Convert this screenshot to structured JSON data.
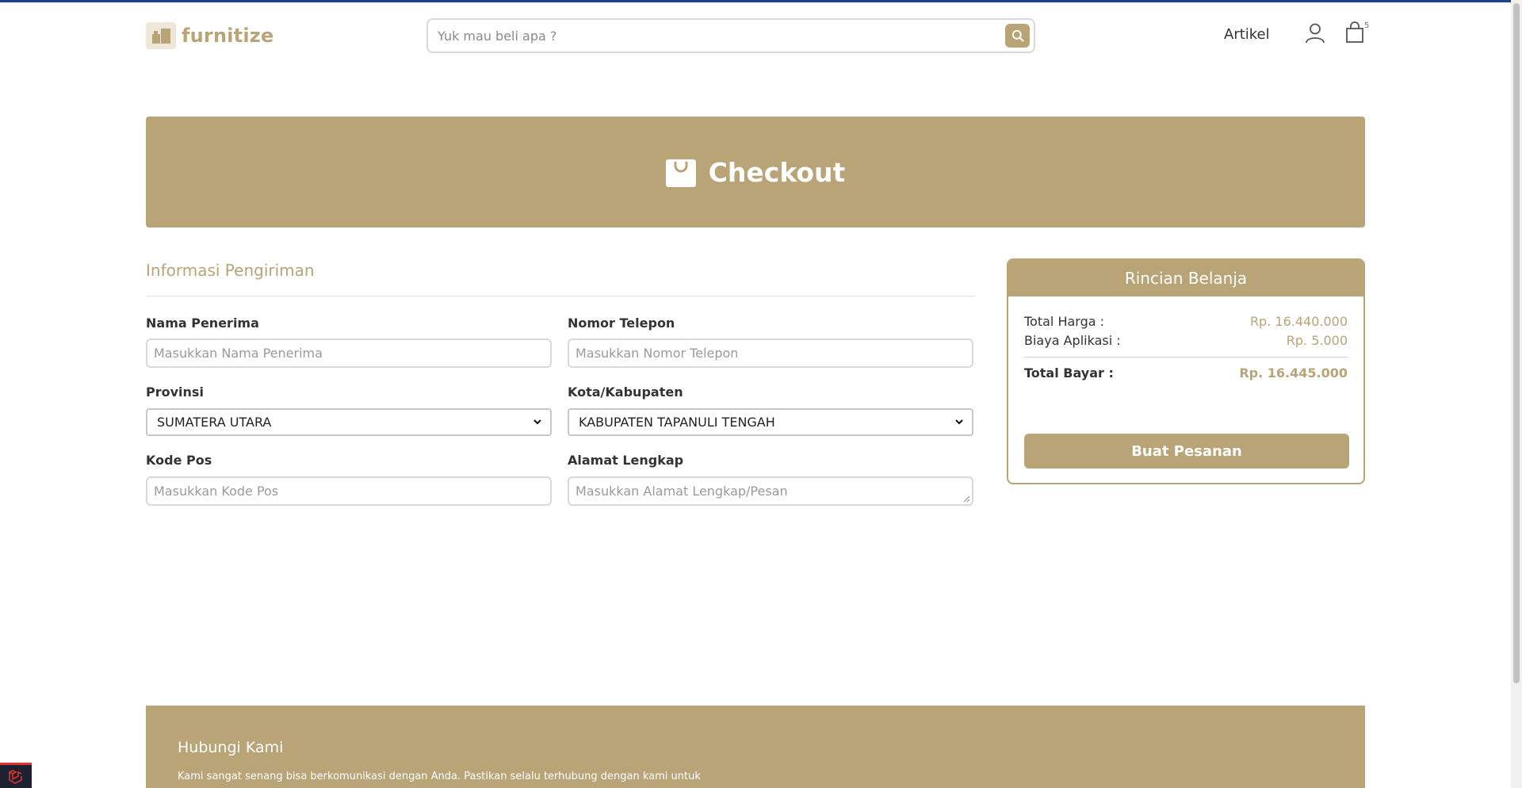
{
  "brand": {
    "name": "furnitize"
  },
  "search": {
    "placeholder": "Yuk mau beli apa ?"
  },
  "nav": {
    "artikel": "Artikel",
    "cart_count": "5"
  },
  "banner": {
    "title": "Checkout"
  },
  "form": {
    "section_title": "Informasi Pengiriman",
    "nama_label": "Nama Penerima",
    "nama_placeholder": "Masukkan Nama Penerima",
    "telepon_label": "Nomor Telepon",
    "telepon_placeholder": "Masukkan Nomor Telepon",
    "provinsi_label": "Provinsi",
    "provinsi_value": "SUMATERA UTARA",
    "kota_label": "Kota/Kabupaten",
    "kota_value": "KABUPATEN TAPANULI TENGAH",
    "kodepos_label": "Kode Pos",
    "kodepos_placeholder": "Masukkan Kode Pos",
    "alamat_label": "Alamat Lengkap",
    "alamat_placeholder": "Masukkan Alamat Lengkap/Pesan"
  },
  "summary": {
    "title": "Rincian Belanja",
    "total_harga_label": "Total Harga :",
    "total_harga_value": "Rp. 16.440.000",
    "biaya_label": "Biaya Aplikasi :",
    "biaya_value": "Rp. 5.000",
    "total_bayar_label": "Total Bayar :",
    "total_bayar_value": "Rp. 16.445.000",
    "button": "Buat Pesanan"
  },
  "footer": {
    "title": "Hubungi Kami",
    "text": "Kami sangat senang bisa berkomunikasi dengan Anda. Pastikan selalu terhubung dengan kami untuk"
  },
  "colors": {
    "accent": "#b8a477",
    "border": "#d9d9d9",
    "topline": "#1f3f8f"
  },
  "icons": [
    "furniture-logo-icon",
    "search-icon",
    "user-icon",
    "shopping-bag-icon",
    "checkout-bag-icon",
    "chevron-down-icon",
    "laravel-icon"
  ]
}
